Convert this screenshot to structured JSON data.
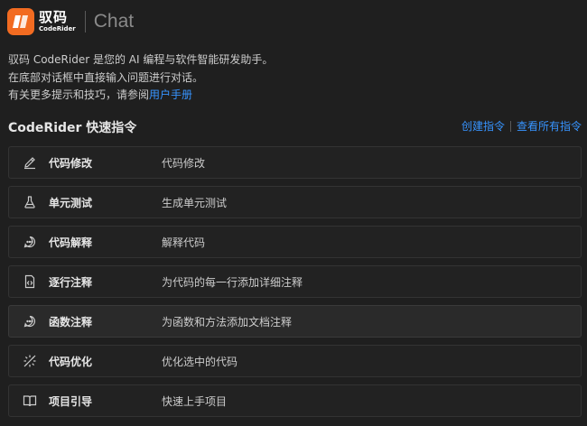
{
  "header": {
    "logo_cn": "驭码",
    "logo_en": "CodeRider",
    "title": "Chat",
    "brand_color": "#f26b21"
  },
  "intro": {
    "line1": "驭码 CodeRider 是您的 AI 编程与软件智能研发助手。",
    "line2": "在底部对话框中直接输入问题进行对话。",
    "line3_prefix": "有关更多提示和技巧，请参阅",
    "line3_link": "用户手册"
  },
  "section": {
    "title": "CodeRider 快速指令",
    "create_link": "创建指令",
    "view_all_link": "查看所有指令"
  },
  "commands": [
    {
      "icon": "pencil-icon",
      "name": "代码修改",
      "desc": "代码修改"
    },
    {
      "icon": "flask-icon",
      "name": "单元测试",
      "desc": "生成单元测试"
    },
    {
      "icon": "chat-bubble-icon",
      "name": "代码解释",
      "desc": "解释代码"
    },
    {
      "icon": "code-file-icon",
      "name": "逐行注释",
      "desc": "为代码的每一行添加详细注释"
    },
    {
      "icon": "chat-bubble-icon",
      "name": "函数注释",
      "desc": "为函数和方法添加文档注释"
    },
    {
      "icon": "sparkle-icon",
      "name": "代码优化",
      "desc": "优化选中的代码"
    },
    {
      "icon": "book-icon",
      "name": "项目引导",
      "desc": "快速上手项目"
    }
  ]
}
